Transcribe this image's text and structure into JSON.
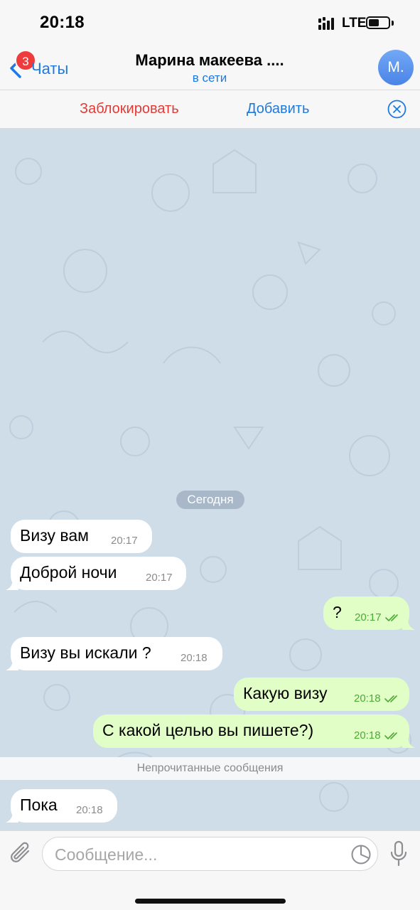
{
  "status_bar": {
    "time": "20:18",
    "network": "LTE"
  },
  "header": {
    "back_label": "Чаты",
    "back_badge": "3",
    "title": "Марина макеева ....",
    "status": "в сети",
    "avatar_initials": "М."
  },
  "actions": {
    "block_label": "Заблокировать",
    "add_label": "Добавить"
  },
  "chat": {
    "date_separator": "Сегодня",
    "unread_label": "Непрочитанные сообщения",
    "messages": [
      {
        "direction": "in",
        "text": "Визу вам",
        "time": "20:17"
      },
      {
        "direction": "in",
        "text": "Доброй ночи",
        "time": "20:17"
      },
      {
        "direction": "out",
        "text": "?",
        "time": "20:17",
        "read": true
      },
      {
        "direction": "in",
        "text": "Визу вы искали ?",
        "time": "20:18"
      },
      {
        "direction": "out",
        "text": "Какую визу",
        "time": "20:18",
        "read": true
      },
      {
        "direction": "out",
        "text": "С какой целью вы пишете?)",
        "time": "20:18",
        "read": true
      },
      {
        "direction": "in",
        "text": "Пока",
        "time": "20:18"
      }
    ]
  },
  "input": {
    "placeholder": "Сообщение..."
  },
  "colors": {
    "accent": "#1e7ae0",
    "danger": "#e53935",
    "wallpaper": "#cfdde9",
    "outgoing_bubble": "#e1fec6",
    "incoming_bubble": "#ffffff",
    "read_checks": "#4bab35",
    "badge": "#ef3b3b"
  },
  "icons": [
    "back-chevron-icon",
    "cellular-signal-icon",
    "battery-icon",
    "close-circle-icon",
    "double-check-icon",
    "paperclip-icon",
    "sticker-icon",
    "microphone-icon"
  ]
}
